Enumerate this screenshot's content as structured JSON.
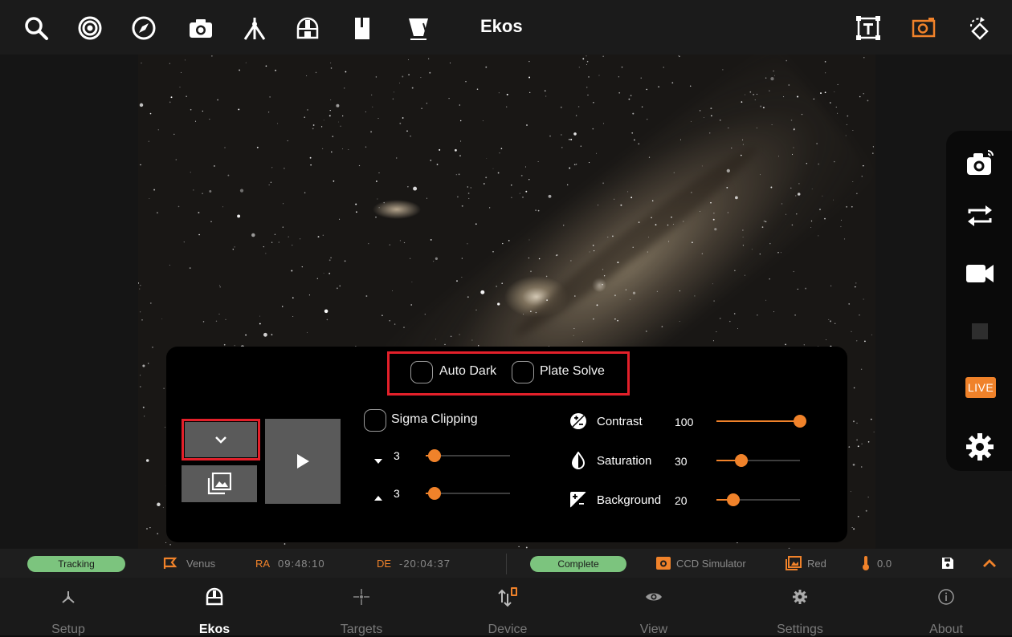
{
  "app": {
    "title": "Ekos"
  },
  "top_toolbar": {
    "left_icons": [
      "search-icon",
      "target-icon",
      "compass-icon",
      "camera-icon",
      "tripod-mount-icon",
      "dome-icon",
      "filter-wheel-icon",
      "telescope-icon"
    ],
    "right_icons": [
      "text-box-icon",
      "capture-frame-icon",
      "rotate-icon"
    ],
    "accent_color": "#f0822a"
  },
  "right_tools": {
    "items": [
      "camera-capture-icon",
      "loop-icon",
      "video-icon",
      "stop-icon",
      "live-badge",
      "settings-gear-icon"
    ],
    "live_label": "LIVE"
  },
  "capture_panel": {
    "auto_dark_label": "Auto Dark",
    "auto_dark_checked": false,
    "plate_solve_label": "Plate Solve",
    "plate_solve_checked": false,
    "sigma_clipping_label": "Sigma Clipping",
    "sigma_clipping_checked": false,
    "sigma_low_value": "3",
    "sigma_low_level": 0.1,
    "sigma_high_value": "3",
    "sigma_high_level": 0.1,
    "contrast_label": "Contrast",
    "contrast_value": "100",
    "contrast_level": 1.0,
    "saturation_label": "Saturation",
    "saturation_value": "30",
    "saturation_level": 0.3,
    "background_label": "Background",
    "background_value": "20",
    "background_level": 0.2,
    "highlight_color": "#e3202a"
  },
  "status_bar": {
    "mount_status": "Tracking",
    "target_name": "Venus",
    "ra_key": "RA",
    "ra_value": "09:48:10",
    "de_key": "DE",
    "de_value": "-20:04:37",
    "capture_status": "Complete",
    "camera_name": "CCD Simulator",
    "filter_name": "Red",
    "temperature": "0.0",
    "status_color": "#7cc47e"
  },
  "bottom_nav": {
    "items": [
      {
        "label": "Setup",
        "icon": "setup-icon"
      },
      {
        "label": "Ekos",
        "icon": "ekos-icon",
        "active": true
      },
      {
        "label": "Targets",
        "icon": "targets-icon"
      },
      {
        "label": "Device",
        "icon": "device-icon"
      },
      {
        "label": "View",
        "icon": "view-icon"
      },
      {
        "label": "Settings",
        "icon": "settings-icon"
      },
      {
        "label": "About",
        "icon": "about-icon"
      }
    ]
  }
}
